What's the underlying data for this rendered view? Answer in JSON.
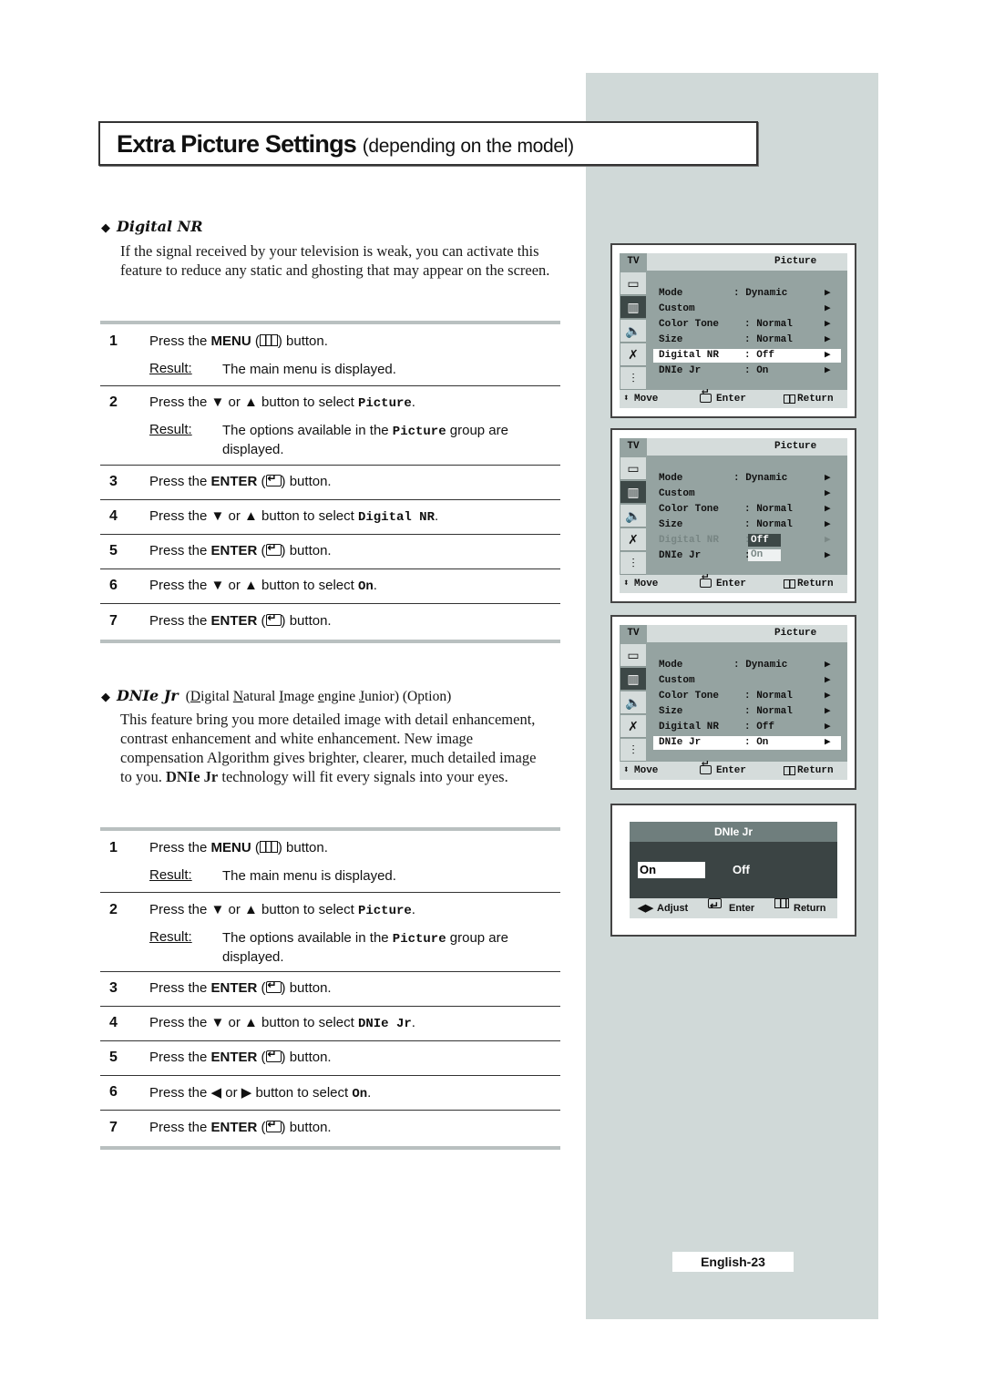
{
  "page": {
    "title": "Extra Picture Settings",
    "subtitle": "(depending on the model)",
    "page_number": "English-23",
    "accent_panel_color": "#d0d9d8"
  },
  "digital_nr": {
    "heading": "Digital NR",
    "description": "If the signal received by your television is weak, you can activate this feature to reduce any static and ghosting that may appear on the screen.",
    "steps": [
      {
        "num": "1",
        "pre": "Press the ",
        "key": "MENU",
        "icon": "menu-icon",
        "post": " button.",
        "result_label": "Result:",
        "result": "The main menu is displayed."
      },
      {
        "num": "2",
        "pre": "Press the ▼ or ▲ button to select ",
        "code": "Picture",
        "post": ".",
        "result_label": "Result:",
        "result_pre": "The options available in the ",
        "result_code": "Picture",
        "result_post": " group are displayed."
      },
      {
        "num": "3",
        "pre": "Press the ",
        "key": "ENTER",
        "icon": "enter-icon",
        "post": " button."
      },
      {
        "num": "4",
        "pre": "Press the ▼ or ▲ button to select ",
        "code": "Digital NR",
        "post": "."
      },
      {
        "num": "5",
        "pre": "Press the ",
        "key": "ENTER",
        "icon": "enter-icon",
        "post": " button."
      },
      {
        "num": "6",
        "pre": "Press the ▼ or ▲ button to select ",
        "code": "On",
        "post": "."
      },
      {
        "num": "7",
        "pre": "Press the ",
        "key": "ENTER",
        "icon": "enter-icon",
        "post": " button."
      }
    ]
  },
  "dnie": {
    "heading": "DNIe Jr",
    "expansion": [
      {
        "u": "D",
        "rest": "igital "
      },
      {
        "u": "N",
        "rest": "atural "
      },
      {
        "u": "I",
        "rest": "mage "
      },
      {
        "u": "e",
        "rest": "ngine "
      },
      {
        "u": "J",
        "rest": "unior"
      }
    ],
    "option_label": "(Option)",
    "description_pre": "This feature bring you more detailed image with detail enhancement, contrast enhancement and white enhancement. New image compensation Algorithm gives brighter, clearer, much detailed image to you. ",
    "description_bold": "DNIe Jr",
    "description_post": " technology will fit every signals into your eyes.",
    "steps": [
      {
        "num": "1",
        "pre": "Press the ",
        "key": "MENU",
        "post": " button.",
        "result_label": "Result:",
        "result": "The main menu is displayed."
      },
      {
        "num": "2",
        "pre": "Press the ▼ or ▲ button to select ",
        "code": "Picture",
        "post": ".",
        "result_label": "Result:",
        "result_pre": "The options available in the ",
        "result_code": "Picture",
        "result_post": " group are displayed."
      },
      {
        "num": "3",
        "pre": "Press the ",
        "key": "ENTER",
        "post": " button."
      },
      {
        "num": "4",
        "pre": "Press the ▼ or ▲ button to select ",
        "code": "DNIe Jr",
        "post": "."
      },
      {
        "num": "5",
        "pre": "Press the ",
        "key": "ENTER",
        "post": " button."
      },
      {
        "num": "6",
        "pre": "Press the ◀ or ▶ button to select ",
        "code": "On",
        "post": "."
      },
      {
        "num": "7",
        "pre": "Press the ",
        "key": "ENTER",
        "post": " button."
      }
    ]
  },
  "osd": {
    "tv_tag": "TV",
    "group": "Picture",
    "side_icons": [
      "input-icon",
      "picture-icon",
      "sound-icon",
      "channel-icon",
      "setup-icon"
    ],
    "rows": [
      {
        "label": "Mode",
        "value": ": Dynamic"
      },
      {
        "label": "Custom",
        "value": ""
      },
      {
        "label": "Color Tone",
        "value": ": Normal"
      },
      {
        "label": "Size",
        "value": ": Normal"
      },
      {
        "label": "Digital NR",
        "value": ": Off"
      },
      {
        "label": "DNIe Jr",
        "value": ": On"
      }
    ],
    "footer": {
      "move": "Move",
      "enter": "Enter",
      "return": "Return"
    },
    "popup_options": [
      "Off",
      "On"
    ]
  },
  "dnie_popup": {
    "title": "DNIe Jr",
    "options": [
      "On",
      "Off"
    ],
    "selected": "On",
    "footer": {
      "adjust": "Adjust",
      "enter": "Enter",
      "return": "Return"
    }
  }
}
